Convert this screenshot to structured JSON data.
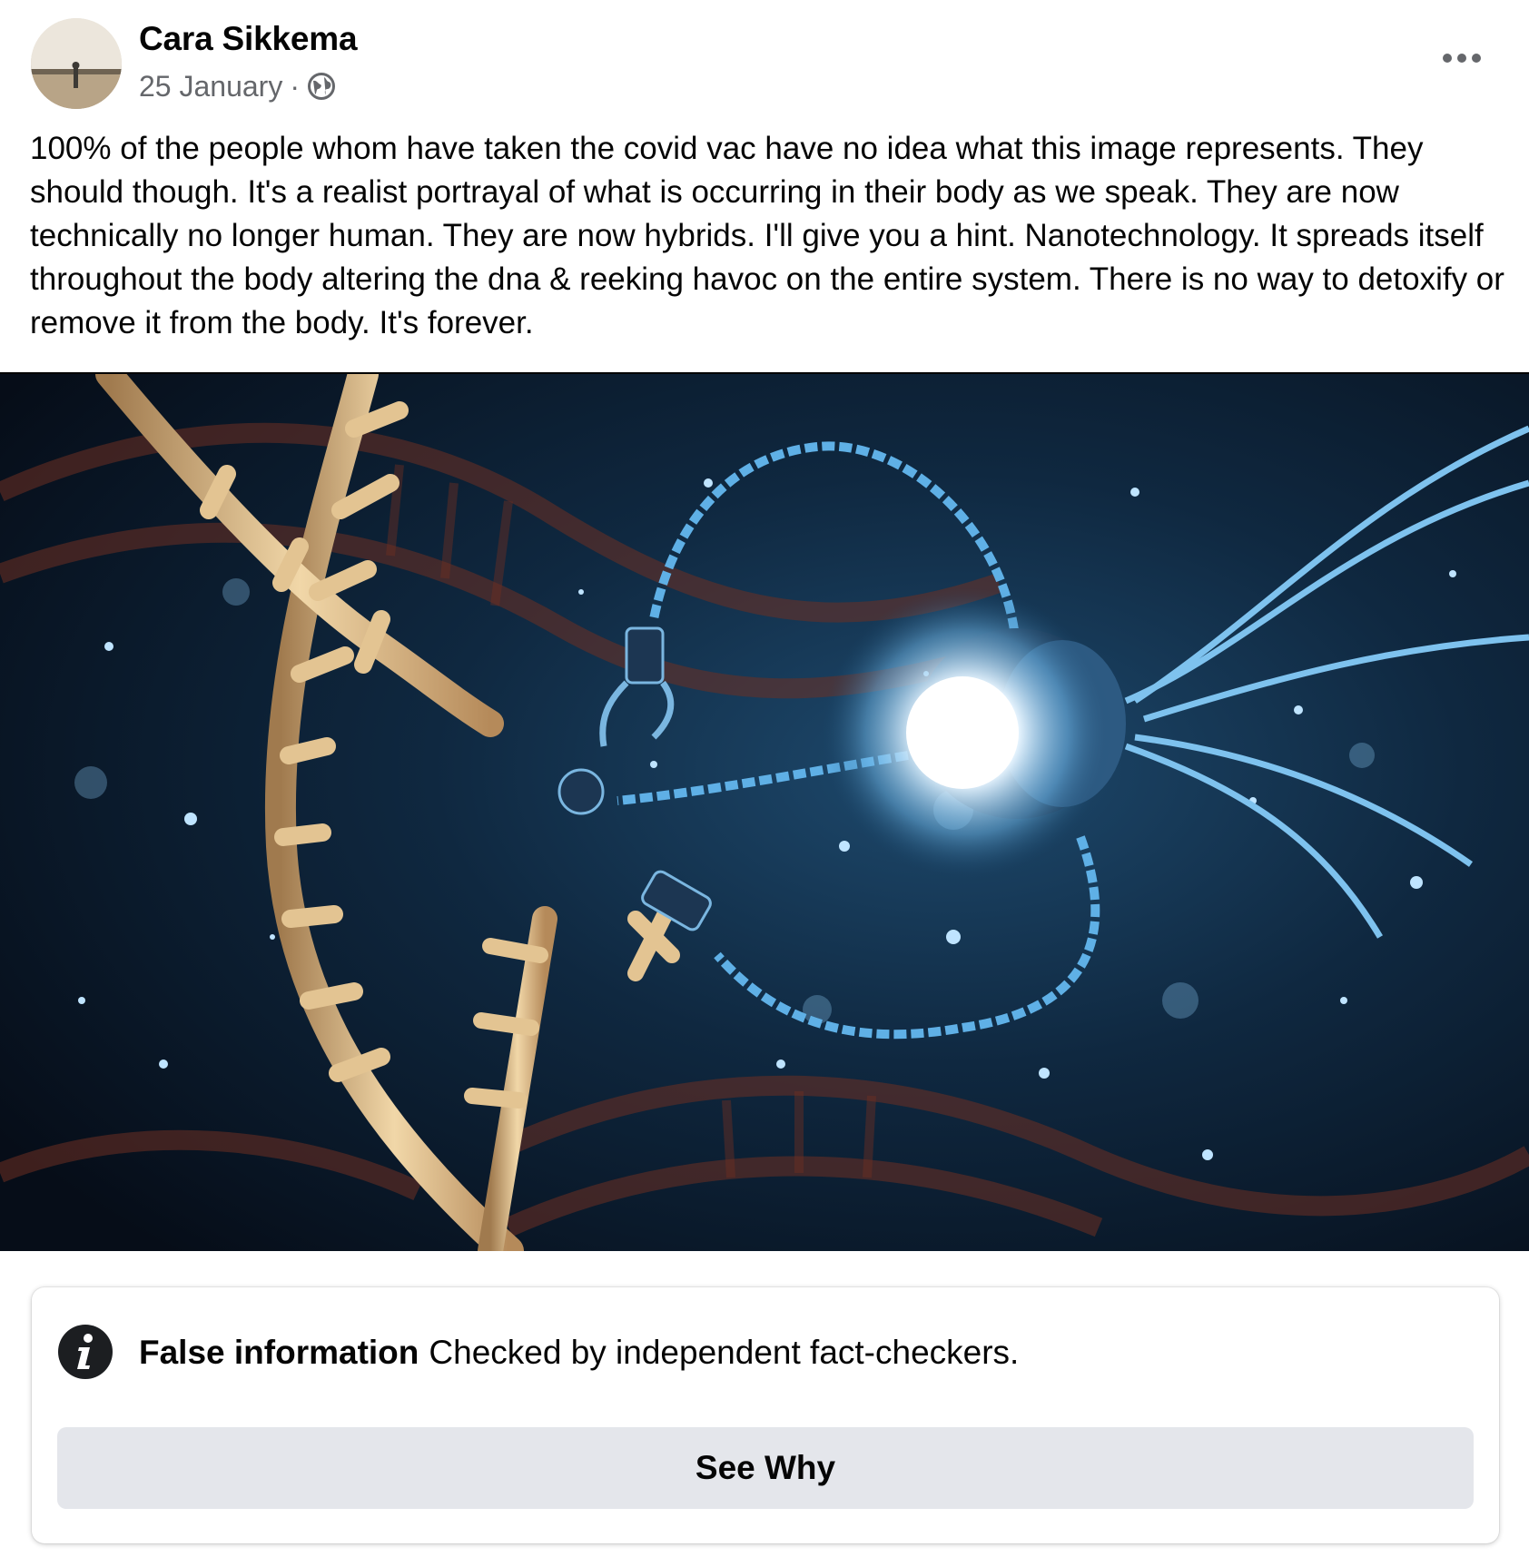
{
  "post": {
    "author": "Cara Sikkema",
    "date": "25 January",
    "separator": "·",
    "audience_icon": "globe-icon",
    "more_icon": "more-options-icon",
    "text": "100% of the people whom have taken the covid vac have no idea what this image represents. They should though. It's a realist portrayal of what is occurring in their body as we speak. They are now technically no longer human. They are now hybrids. I'll give you a hint. Nanotechnology. It spreads itself throughout the body altering the dna & reeking havoc on the entire system. There is no way to detoxify or remove it from the body.  It's forever."
  },
  "fact_check": {
    "icon": "info-icon",
    "label": "False information",
    "description": "Checked by independent fact-checkers.",
    "button_label": "See Why"
  },
  "colors": {
    "meta_gray": "#65676b",
    "button_bg": "#e4e6eb",
    "image_bg": "#0a1626",
    "nanobot_glow": "#ffffff",
    "dna_strand": "#e0c08e"
  }
}
